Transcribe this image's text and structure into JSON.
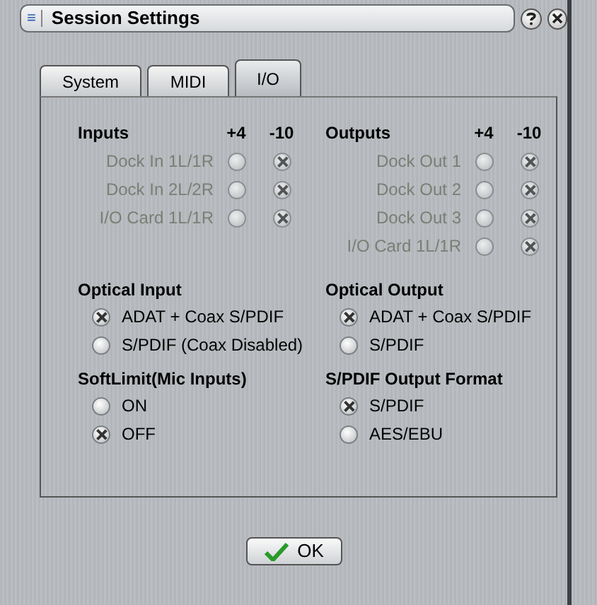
{
  "window": {
    "title": "Session Settings",
    "menu_glyph": "≡"
  },
  "tabs": [
    {
      "label": "System",
      "selected": false
    },
    {
      "label": "MIDI",
      "selected": false
    },
    {
      "label": "I/O",
      "selected": true
    }
  ],
  "inputs": {
    "title": "Inputs",
    "columns": [
      "+4",
      "-10"
    ],
    "rows": [
      {
        "label": "Dock In 1L/1R",
        "disabled": true,
        "plus4": false,
        "minus10": true
      },
      {
        "label": "Dock In 2L/2R",
        "disabled": true,
        "plus4": false,
        "minus10": true
      },
      {
        "label": "I/O Card 1L/1R",
        "disabled": true,
        "plus4": false,
        "minus10": true
      }
    ]
  },
  "outputs": {
    "title": "Outputs",
    "columns": [
      "+4",
      "-10"
    ],
    "rows": [
      {
        "label": "Dock Out 1",
        "disabled": true,
        "plus4": false,
        "minus10": true
      },
      {
        "label": "Dock Out 2",
        "disabled": true,
        "plus4": false,
        "minus10": true
      },
      {
        "label": "Dock Out 3",
        "disabled": true,
        "plus4": false,
        "minus10": true
      },
      {
        "label": "I/O Card 1L/1R",
        "disabled": true,
        "plus4": false,
        "minus10": true
      }
    ]
  },
  "groups": [
    {
      "title": "Optical Input",
      "options": [
        {
          "label": "ADAT + Coax S/PDIF",
          "selected": true
        },
        {
          "label": "S/PDIF (Coax Disabled)",
          "selected": false
        }
      ]
    },
    {
      "title": "Optical Output",
      "options": [
        {
          "label": "ADAT + Coax S/PDIF",
          "selected": true
        },
        {
          "label": "S/PDIF",
          "selected": false
        }
      ]
    },
    {
      "title": "SoftLimit(Mic Inputs)",
      "options": [
        {
          "label": "ON",
          "selected": false
        },
        {
          "label": "OFF",
          "selected": true
        }
      ]
    },
    {
      "title": "S/PDIF Output Format",
      "options": [
        {
          "label": "S/PDIF",
          "selected": true
        },
        {
          "label": "AES/EBU",
          "selected": false
        }
      ]
    }
  ],
  "ok_button": {
    "label": "OK"
  }
}
